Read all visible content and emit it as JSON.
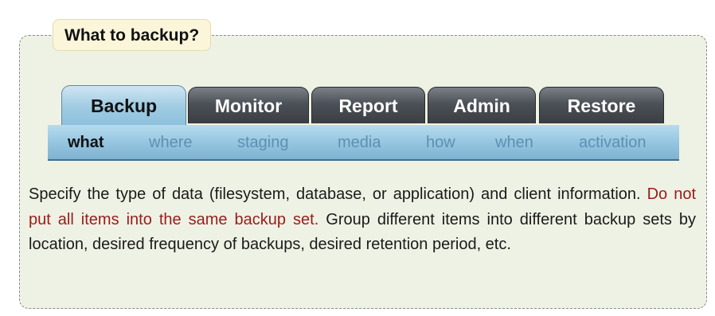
{
  "panel": {
    "title": "What to backup?"
  },
  "tabs": [
    {
      "label": "Backup",
      "active": true
    },
    {
      "label": "Monitor",
      "active": false
    },
    {
      "label": "Report",
      "active": false
    },
    {
      "label": "Admin",
      "active": false
    },
    {
      "label": "Restore",
      "active": false
    }
  ],
  "subnav": [
    {
      "label": "what",
      "active": true
    },
    {
      "label": "where",
      "active": false
    },
    {
      "label": "staging",
      "active": false
    },
    {
      "label": "media",
      "active": false
    },
    {
      "label": "how",
      "active": false
    },
    {
      "label": "when",
      "active": false
    },
    {
      "label": "activation",
      "active": false
    }
  ],
  "description": {
    "part1": "Specify the type of data (filesystem, database, or application) and client information. ",
    "warning": "Do not put all items into the same backup set.",
    "part2": " Group different items into different backup sets by location, desired frequency of backups, desired retention period, etc."
  },
  "colors": {
    "panel_bg": "#eef2e4",
    "active_tab": "#9fcbe2",
    "inactive_tab": "#4c5157",
    "warning_text": "#9a1b1b",
    "subnav_inactive_text": "#5f8fb0"
  }
}
